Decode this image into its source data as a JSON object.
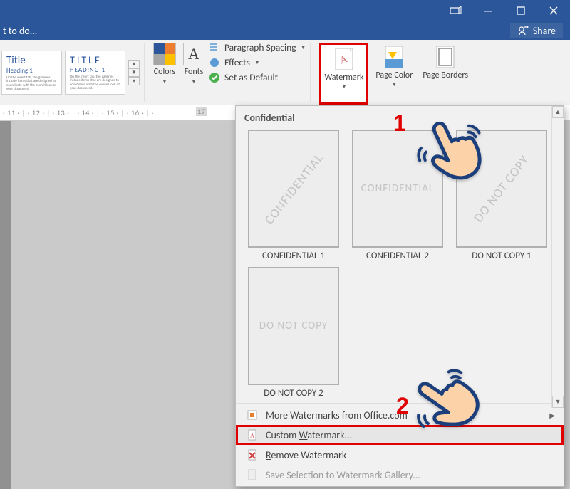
{
  "titlebar": {
    "tell_me": "t to do..."
  },
  "share_label": "Share",
  "styles": [
    {
      "title": "Title",
      "heading": "Heading 1"
    },
    {
      "title": "TITLE",
      "heading": "HEADING 1"
    }
  ],
  "ribbon": {
    "colors": "Colors",
    "fonts": "Fonts",
    "paragraph_spacing": "Paragraph Spacing",
    "effects": "Effects",
    "set_default": "Set as Default",
    "watermark": "Watermark",
    "page_color": "Page Color",
    "page_borders": "Page Borders"
  },
  "ruler": "· 11 · | · 12 · | · 13 · | · 14 · | · 15 · | · 16 · | ·",
  "ruler_end": "17",
  "dropdown": {
    "section": "Confidential",
    "thumbs": [
      {
        "label": "CONFIDENTIAL 1",
        "wm": "CONFIDENTIAL",
        "diag": true
      },
      {
        "label": "CONFIDENTIAL 2",
        "wm": "CONFIDENTIAL",
        "diag": false
      },
      {
        "label": "DO NOT COPY 1",
        "wm": "DO NOT COPY",
        "diag": true
      },
      {
        "label": "DO NOT COPY 2",
        "wm": "DO NOT COPY",
        "diag": false
      }
    ],
    "more": "More Watermarks from Office.com",
    "custom_pre": "Custom ",
    "custom_u": "W",
    "custom_post": "atermark...",
    "remove_u": "R",
    "remove_post": "emove Watermark",
    "save_gallery": "Save Selection to Watermark Gallery..."
  },
  "annotations": {
    "one": "1",
    "two": "2"
  }
}
